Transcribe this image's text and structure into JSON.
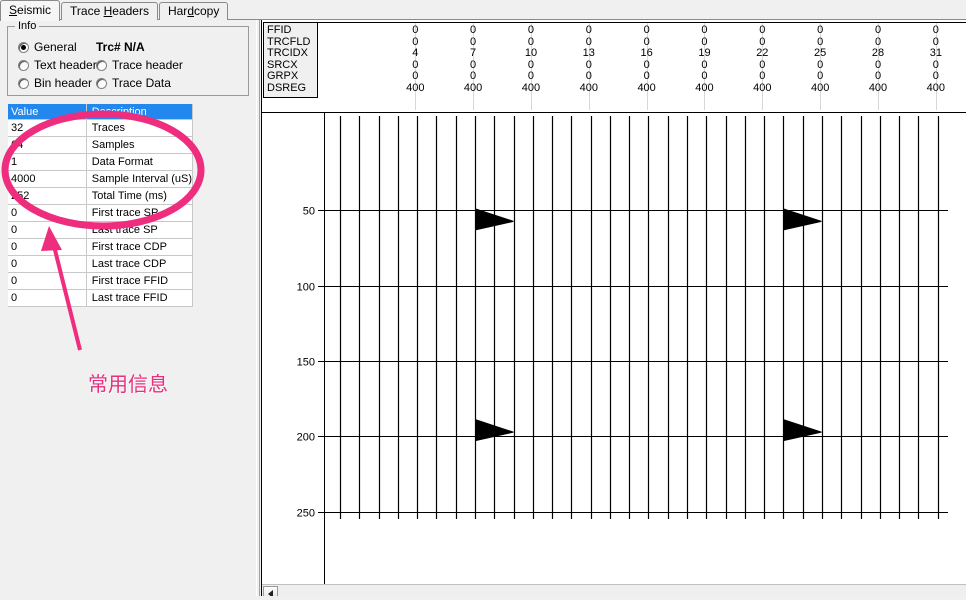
{
  "window": {
    "tabs": [
      {
        "label": "Seismic",
        "accel": "S",
        "active": true
      },
      {
        "label": "Trace Headers",
        "accel": "H",
        "active": false
      },
      {
        "label": "Hardcopy",
        "accel": "d",
        "active": false
      }
    ]
  },
  "info_group": {
    "title": "Info",
    "trace_number_label": "Trc# N/A",
    "radios": [
      {
        "label": "General",
        "checked": true
      },
      {
        "label": "Text header",
        "checked": false
      },
      {
        "label": "Bin header",
        "checked": false
      },
      {
        "label": "Trace header",
        "checked": false
      },
      {
        "label": "Trace Data",
        "checked": false
      }
    ]
  },
  "info_table": {
    "columns": [
      "Value",
      "Description"
    ],
    "rows": [
      {
        "value": "32",
        "description": "Traces"
      },
      {
        "value": "64",
        "description": "Samples"
      },
      {
        "value": "1",
        "description": "Data Format"
      },
      {
        "value": "4000",
        "description": "Sample Interval (uS)"
      },
      {
        "value": "252",
        "description": "Total Time (ms)"
      },
      {
        "value": "0",
        "description": "First trace SP"
      },
      {
        "value": "0",
        "description": "Last  trace SP"
      },
      {
        "value": "0",
        "description": "First trace CDP"
      },
      {
        "value": "0",
        "description": "Last  trace CDP"
      },
      {
        "value": "0",
        "description": "First trace FFID"
      },
      {
        "value": "0",
        "description": "Last  trace FFID"
      }
    ]
  },
  "annotation": {
    "text": "常用信息",
    "color": "#e8307e"
  },
  "header_panel": {
    "row_names": [
      "FFID",
      "TRCFLD",
      "TRCIDX",
      "SRCX",
      "GRPX",
      "DSREG"
    ],
    "columns": [
      {
        "FFID": "0",
        "TRCFLD": "0",
        "TRCIDX": "4",
        "SRCX": "0",
        "GRPX": "0",
        "DSREG": "400"
      },
      {
        "FFID": "0",
        "TRCFLD": "0",
        "TRCIDX": "7",
        "SRCX": "0",
        "GRPX": "0",
        "DSREG": "400"
      },
      {
        "FFID": "0",
        "TRCFLD": "0",
        "TRCIDX": "10",
        "SRCX": "0",
        "GRPX": "0",
        "DSREG": "400"
      },
      {
        "FFID": "0",
        "TRCFLD": "0",
        "TRCIDX": "13",
        "SRCX": "0",
        "GRPX": "0",
        "DSREG": "400"
      },
      {
        "FFID": "0",
        "TRCFLD": "0",
        "TRCIDX": "16",
        "SRCX": "0",
        "GRPX": "0",
        "DSREG": "400"
      },
      {
        "FFID": "0",
        "TRCFLD": "0",
        "TRCIDX": "19",
        "SRCX": "0",
        "GRPX": "0",
        "DSREG": "400"
      },
      {
        "FFID": "0",
        "TRCFLD": "0",
        "TRCIDX": "22",
        "SRCX": "0",
        "GRPX": "0",
        "DSREG": "400"
      },
      {
        "FFID": "0",
        "TRCFLD": "0",
        "TRCIDX": "25",
        "SRCX": "0",
        "GRPX": "0",
        "DSREG": "400"
      },
      {
        "FFID": "0",
        "TRCFLD": "0",
        "TRCIDX": "28",
        "SRCX": "0",
        "GRPX": "0",
        "DSREG": "400"
      },
      {
        "FFID": "0",
        "TRCFLD": "0",
        "TRCIDX": "31",
        "SRCX": "0",
        "GRPX": "0",
        "DSREG": "400"
      }
    ]
  },
  "chart_data": {
    "type": "line",
    "title": "",
    "xlabel": "",
    "ylabel": "",
    "ytick_labels": [
      "50",
      "100",
      "150",
      "200",
      "250"
    ],
    "ytick_values": [
      50,
      100,
      150,
      200,
      250
    ],
    "ylim": [
      0,
      260
    ],
    "grid": true,
    "trace_count": 32,
    "trace_indices": [
      1,
      2,
      3,
      4,
      5,
      6,
      7,
      8,
      9,
      10,
      11,
      12,
      13,
      14,
      15,
      16,
      17,
      18,
      19,
      20,
      21,
      22,
      23,
      24,
      25,
      26,
      27,
      28,
      29,
      30,
      31,
      32
    ],
    "events": [
      {
        "trace": 8,
        "time_ms": 56,
        "amplitude": "wedge"
      },
      {
        "trace": 24,
        "time_ms": 56,
        "amplitude": "wedge"
      },
      {
        "trace": 8,
        "time_ms": 196,
        "amplitude": "wedge"
      },
      {
        "trace": 24,
        "time_ms": 196,
        "amplitude": "wedge"
      }
    ]
  },
  "scrollbar": {
    "left_arrow": "◀"
  }
}
